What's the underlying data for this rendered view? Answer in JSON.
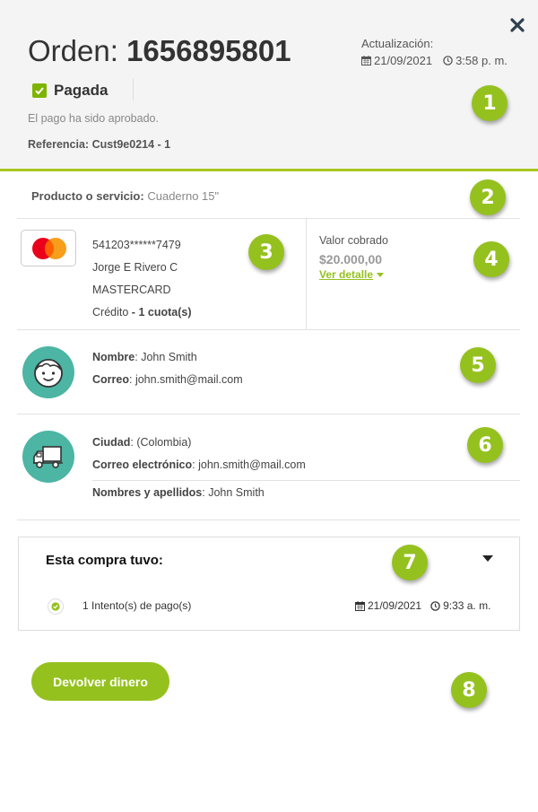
{
  "header": {
    "order_label": "Orden:",
    "order_number": "1656895801",
    "update_label": "Actualización:",
    "update_date": "21/09/2021",
    "update_time": "3:58 p. m.",
    "status": "Pagada",
    "status_message": "El pago ha sido aprobado.",
    "reference_label": "Referencia:",
    "reference_value": "Cust9e0214 - 1"
  },
  "product": {
    "label": "Producto o servicio",
    "value": "Cuaderno 15\""
  },
  "card": {
    "number": "541203******7479",
    "holder": "Jorge E Rivero C",
    "brand": "MASTERCARD",
    "type": "Crédito",
    "installments": "1 cuota(s)"
  },
  "amount": {
    "label": "Valor cobrado",
    "value": "$20.000,00",
    "detail_link": "Ver detalle"
  },
  "customer": {
    "name_label": "Nombre",
    "name": "John Smith",
    "email_label": "Correo",
    "email": "john.smith@mail.com"
  },
  "shipping": {
    "city_label": "Ciudad",
    "city": "(Colombia)",
    "email_label": "Correo electrónico",
    "email": "john.smith@mail.com",
    "fullname_label": "Nombres y apellidos",
    "fullname": "John Smith"
  },
  "attempts": {
    "title": "Esta compra tuvo",
    "item_text": "1 Intento(s) de pago(s)",
    "item_date": "21/09/2021",
    "item_time": "9:33 a. m."
  },
  "refund_button": "Devolver dinero",
  "badges": [
    "1",
    "2",
    "3",
    "4",
    "5",
    "6",
    "7",
    "8"
  ],
  "colors": {
    "accent": "#95c11f",
    "teal": "#4cb5a3",
    "header_bg": "#f4f4f4"
  }
}
